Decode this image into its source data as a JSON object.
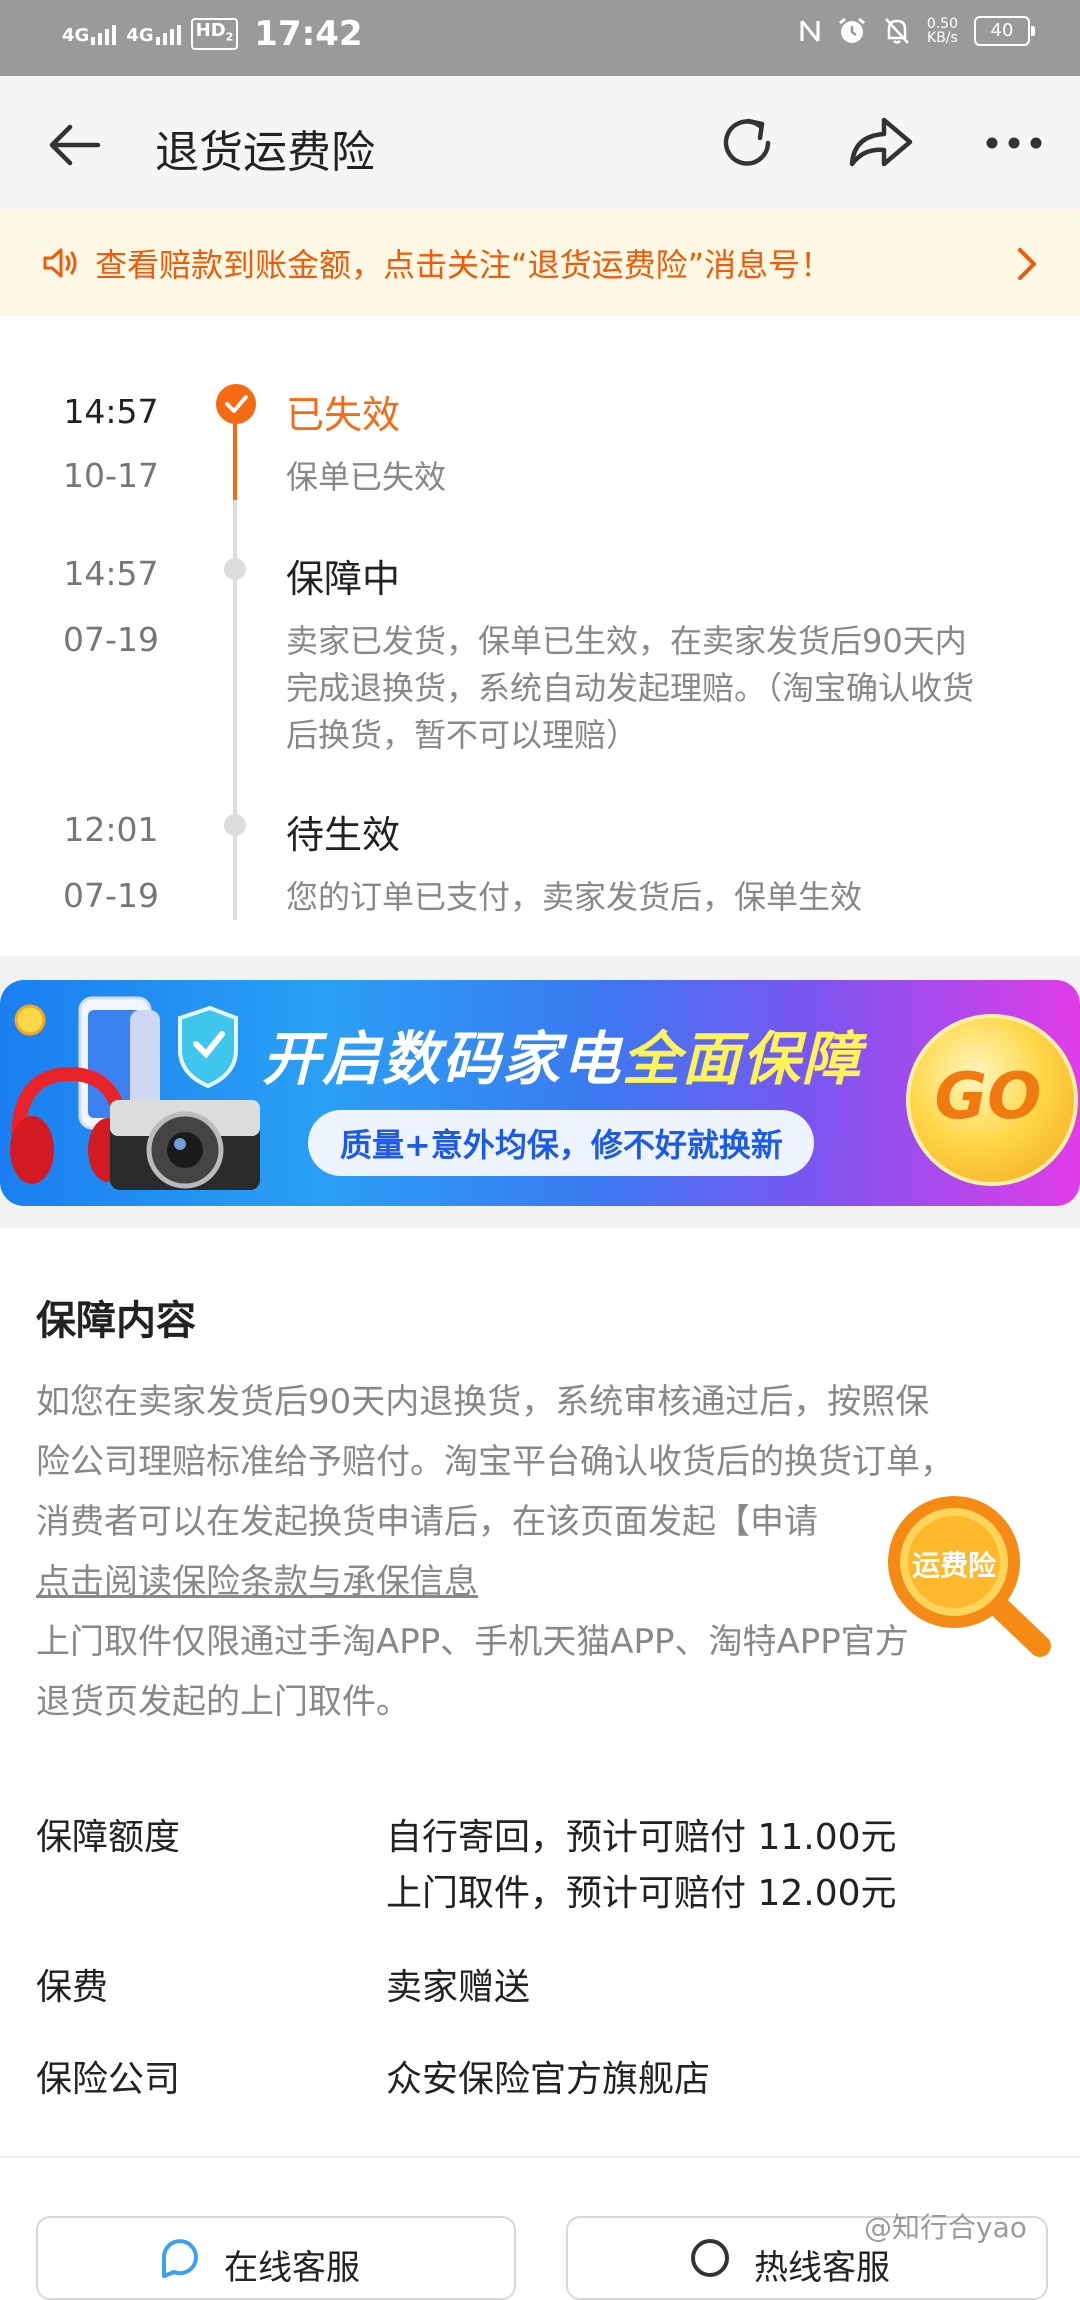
{
  "status_bar": {
    "network_1": "4G",
    "network_2": "4G",
    "hd": "HD",
    "hd_sub": "2",
    "time": "17:42",
    "speed_value": "0.50",
    "speed_unit": "KB/s",
    "battery": "40",
    "icons": [
      "nfc-icon",
      "alarm-icon",
      "mute-icon"
    ]
  },
  "header": {
    "title": "退货运费险",
    "icons": [
      "back-arrow-icon",
      "refresh-icon",
      "share-icon",
      "more-icon"
    ]
  },
  "notice": {
    "text": "查看赔款到账金额，点击关注“退货运费险”消息号！",
    "color": "#f05a0a",
    "icons": [
      "speaker-icon",
      "chevron-right-icon"
    ]
  },
  "timeline": [
    {
      "time": "14:57",
      "date": "10-17",
      "status": "已失效",
      "desc": [
        "保单已失效"
      ],
      "active": true
    },
    {
      "time": "14:57",
      "date": "07-19",
      "status": "保障中",
      "desc": [
        "卖家已发货，保单已生效，在卖家发货后90天内",
        "完成退换货，系统自动发起理赔。（淘宝确认收货",
        "后换货，暂不可以理赔）"
      ],
      "active": false
    },
    {
      "time": "12:01",
      "date": "07-19",
      "status": "待生效",
      "desc": [
        "您的订单已支付，卖家发货后，保单生效"
      ],
      "active": false
    }
  ],
  "banner": {
    "title_part1": "开启数码家电",
    "title_part2": "全面保障",
    "subtitle": "质量+意外均保，修不好就换新",
    "go": "GO"
  },
  "coverage": {
    "title": "保障内容",
    "lines": [
      "如您在卖家发货后90天内退换货，系统审核通过后，按照保",
      "险公司理赔标准给予赔付。淘宝平台确认收货后的换货订单，",
      "消费者可以在发起换货申请后，在该页面发起【申请"
    ],
    "link": "点击阅读保险条款与承保信息",
    "pickup_lines": [
      "上门取件仅限通过手淘APP、手机天猫APP、淘特APP官方",
      "退货页发起的上门取件。"
    ]
  },
  "floating_badge": {
    "label": "运费险"
  },
  "details": {
    "amount_label": "保障额度",
    "amount_value_1": "自行寄回，预计可赔付 11.00元",
    "amount_value_2": "上门取件，预计可赔付 12.00元",
    "fee_label": "保费",
    "fee_value": "卖家赠送",
    "company_label": "保险公司",
    "company_value": "众安保险官方旗舰店"
  },
  "bottom": {
    "btn_online": "在线客服",
    "btn_hotline": "热线客服",
    "watermark": "@知行合yao"
  },
  "colors": {
    "accent": "#f56a13",
    "notice_bg": "#fdf8e4",
    "status_bar_bg": "#9a9a9a"
  }
}
